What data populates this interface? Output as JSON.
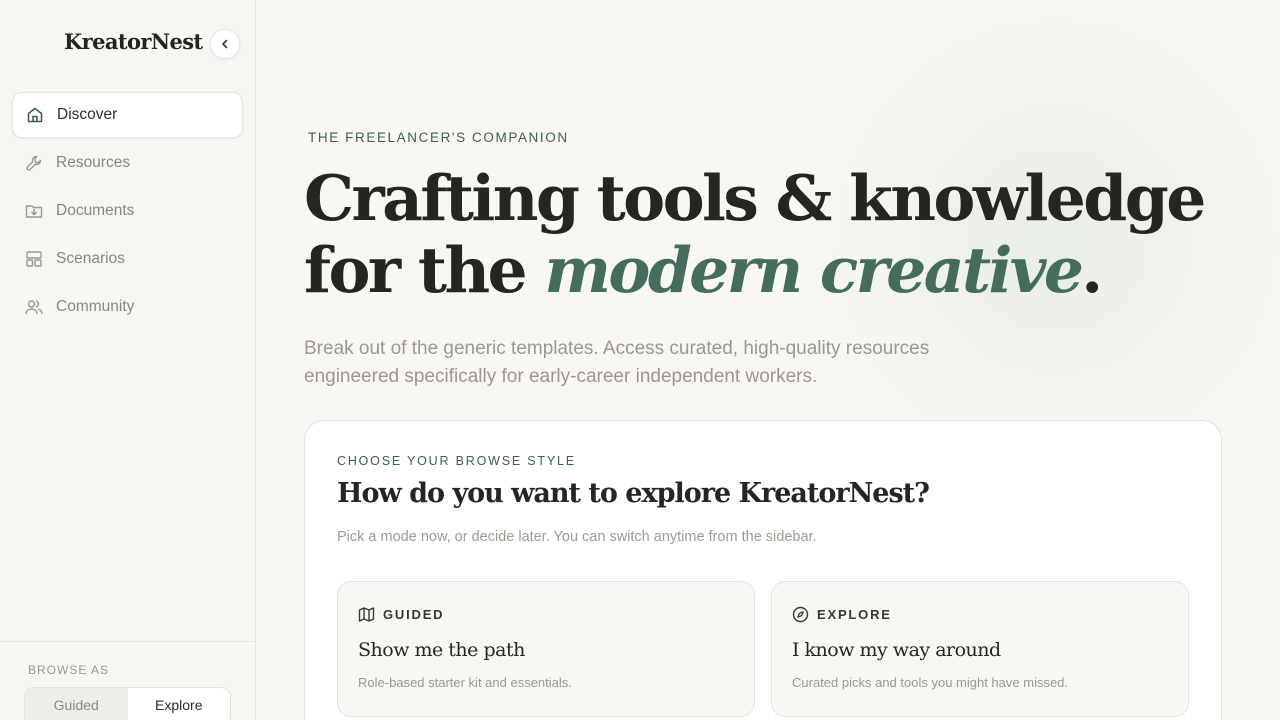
{
  "sidebar": {
    "brand": "KreatorNest",
    "collapse_icon": "chevron-left-icon",
    "items": [
      {
        "label": "Discover",
        "icon": "home-icon",
        "active": true
      },
      {
        "label": "Resources",
        "icon": "wrench-icon",
        "active": false
      },
      {
        "label": "Documents",
        "icon": "folder-download-icon",
        "active": false
      },
      {
        "label": "Scenarios",
        "icon": "layout-icon",
        "active": false
      },
      {
        "label": "Community",
        "icon": "users-icon",
        "active": false
      }
    ],
    "footer": {
      "label": "BROWSE AS",
      "options": [
        "Guided",
        "Explore"
      ],
      "selected": "Explore"
    }
  },
  "hero": {
    "eyebrow": "THE FREELANCER'S COMPANION",
    "headline_line1": "Crafting tools & knowledge",
    "headline_line2_prefix": "for the ",
    "headline_accent": "modern creative",
    "headline_suffix": ".",
    "subhead": "Break out of the generic templates. Access curated, high-quality resources engineered specifically for early-career independent workers."
  },
  "browse_card": {
    "eyebrow": "CHOOSE YOUR BROWSE STYLE",
    "title": "How do you want to explore KreatorNest?",
    "subtitle": "Pick a mode now, or decide later. You can switch anytime from the sidebar.",
    "modes": [
      {
        "kicker": "GUIDED",
        "icon": "map-icon",
        "title": "Show me the path",
        "description": "Role-based starter kit and essentials."
      },
      {
        "kicker": "EXPLORE",
        "icon": "compass-icon",
        "title": "I know my way around",
        "description": "Curated picks and tools you might have missed."
      }
    ]
  },
  "colors": {
    "accent": "#456d5e",
    "background": "#f8f7f4",
    "text": "#262521",
    "muted": "#9c978e"
  }
}
